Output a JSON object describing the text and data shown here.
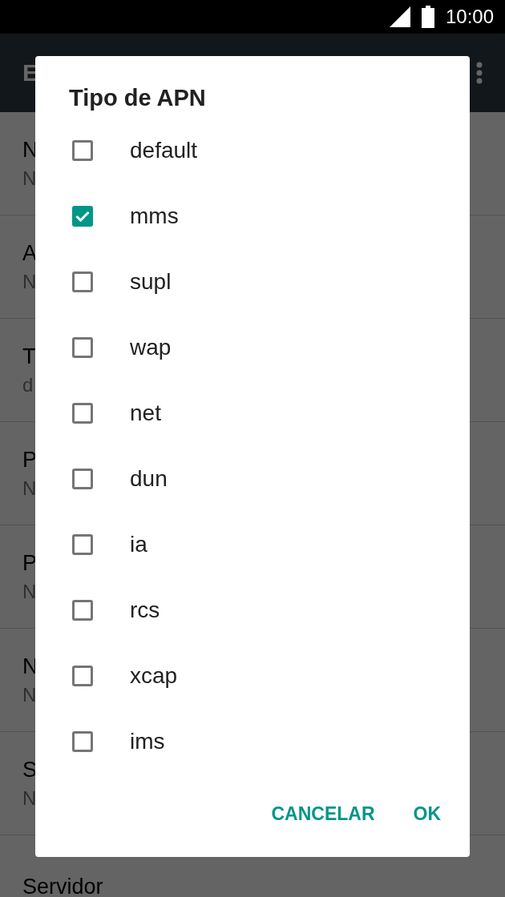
{
  "status_bar": {
    "time": "10:00"
  },
  "app_bar": {
    "title": "E"
  },
  "settings_list": [
    {
      "title": "N",
      "subtitle": "N"
    },
    {
      "title": "A",
      "subtitle": "N"
    },
    {
      "title": "T",
      "subtitle": "d"
    },
    {
      "title": "P",
      "subtitle": "N"
    },
    {
      "title": "P",
      "subtitle": "N"
    },
    {
      "title": "N",
      "subtitle": "N"
    },
    {
      "title": "S",
      "subtitle": "N"
    },
    {
      "title": "Servidor"
    }
  ],
  "dialog": {
    "title": "Tipo de APN",
    "options": [
      {
        "label": "default",
        "checked": false
      },
      {
        "label": "mms",
        "checked": true
      },
      {
        "label": "supl",
        "checked": false
      },
      {
        "label": "wap",
        "checked": false
      },
      {
        "label": "net",
        "checked": false
      },
      {
        "label": "dun",
        "checked": false
      },
      {
        "label": "ia",
        "checked": false
      },
      {
        "label": "rcs",
        "checked": false
      },
      {
        "label": "xcap",
        "checked": false
      },
      {
        "label": "ims",
        "checked": false
      }
    ],
    "buttons": [
      "CANCELAR",
      "OK"
    ]
  }
}
